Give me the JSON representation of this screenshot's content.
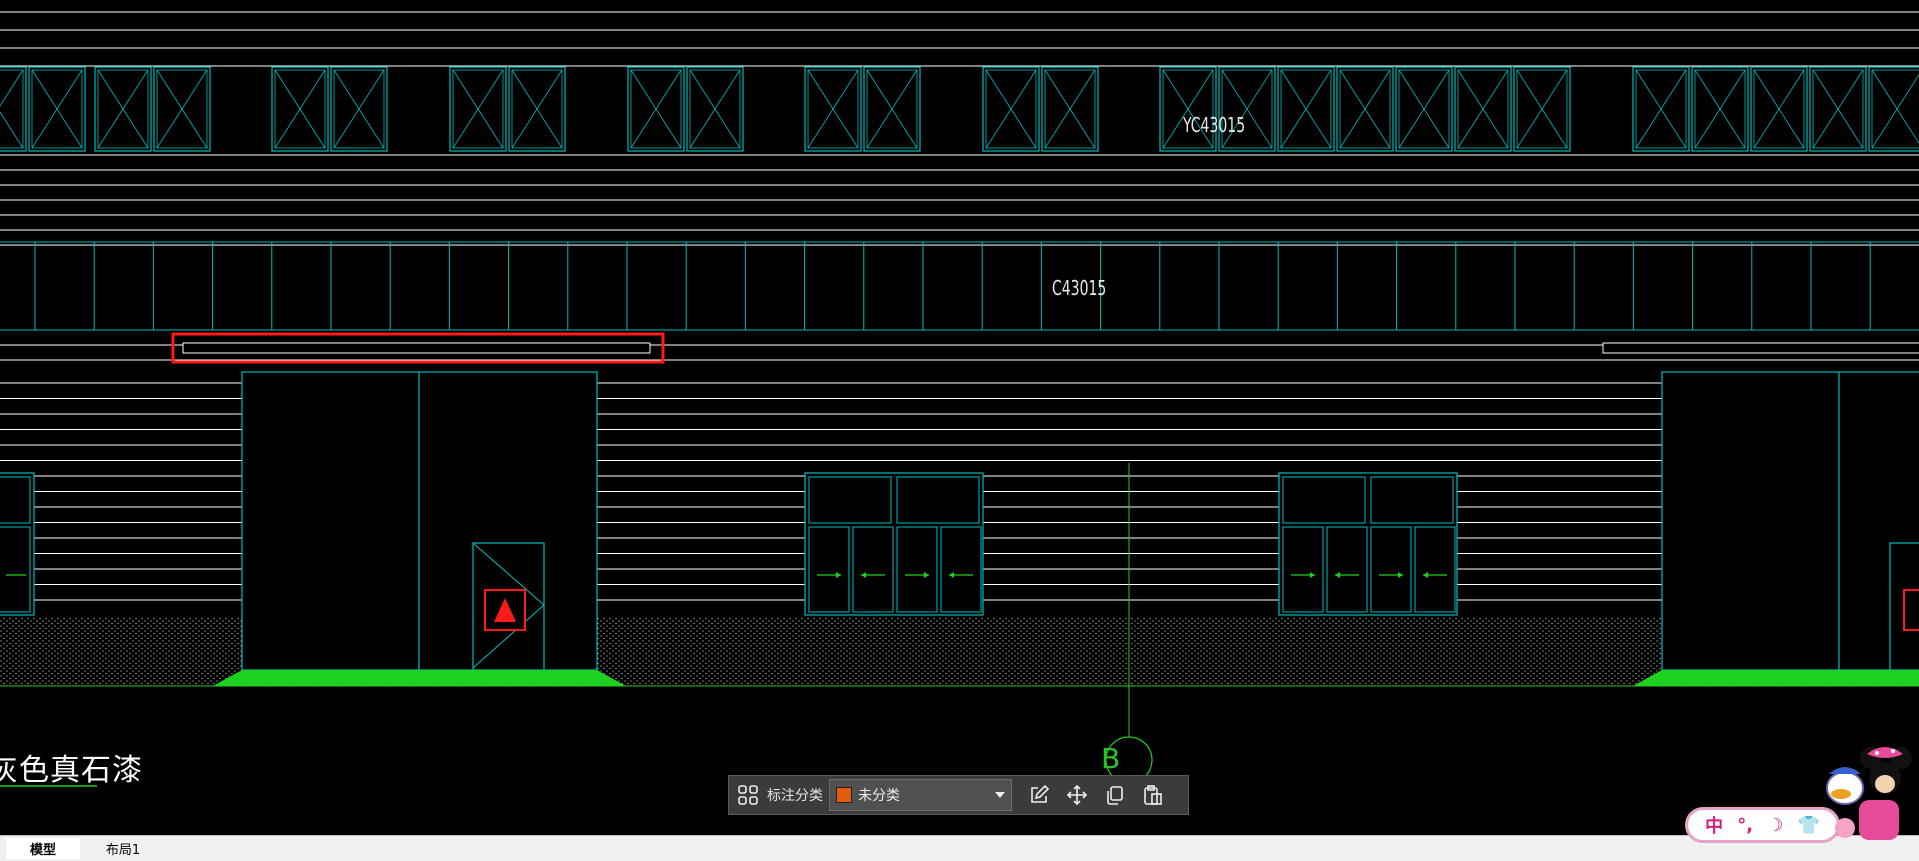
{
  "drawing": {
    "window_label_upper": "YC43015",
    "window_label_lower": "C43015",
    "material_note": "灰色真石漆",
    "axis_label": "B"
  },
  "toolbar": {
    "label": "标注分类",
    "selected_value": "未分类",
    "swatch_color": "#e05a10",
    "icons": [
      "grid-icon",
      "edit-icon",
      "move-icon",
      "copy-icon",
      "paste-icon"
    ]
  },
  "tabs": [
    {
      "label": "模型"
    },
    {
      "label": "布局1"
    }
  ],
  "ime": {
    "items": [
      "中",
      "°,",
      "☽",
      "👕"
    ]
  },
  "colors": {
    "background": "#000000",
    "wall_lines": "#ffffff",
    "window_lines": "#00bcbc",
    "ground": "#1fd11f",
    "highlight": "#ff1a1a"
  }
}
